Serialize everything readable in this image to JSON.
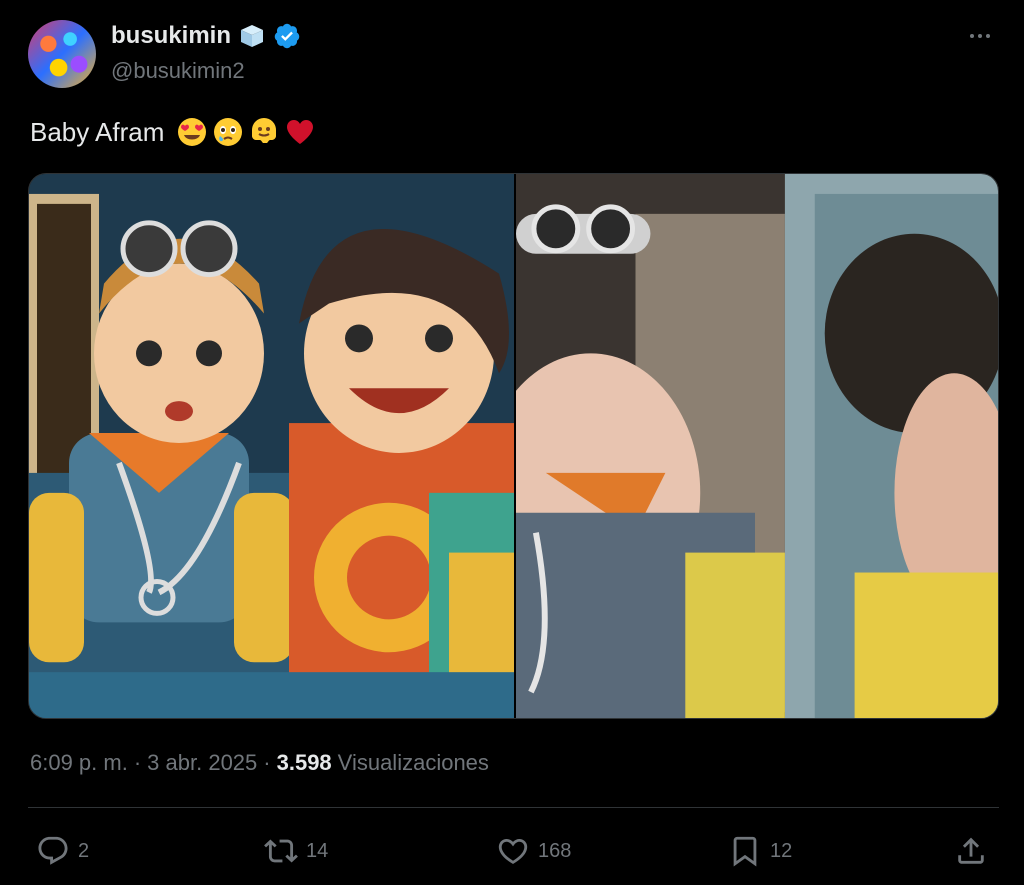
{
  "author": {
    "display_name": "busukimin",
    "handle": "@busukimin2",
    "verified": true
  },
  "tweet": {
    "text": "Baby Afram",
    "emojis": [
      "smiling-face-with-heart-eyes",
      "face-holding-back-tears",
      "melting-face",
      "red-heart"
    ]
  },
  "meta": {
    "time": "6:09 p. m.",
    "dot1": "·",
    "date": "3 abr. 2025",
    "dot2": "·",
    "views_count": "3.598",
    "views_label": "Visualizaciones"
  },
  "actions": {
    "replies": "2",
    "reposts": "14",
    "likes": "168",
    "bookmarks": "12"
  },
  "colors": {
    "background": "#000000",
    "text": "#e7e9ea",
    "muted": "#71767b",
    "verified": "#1d9bf0",
    "divider": "#2f3336"
  }
}
